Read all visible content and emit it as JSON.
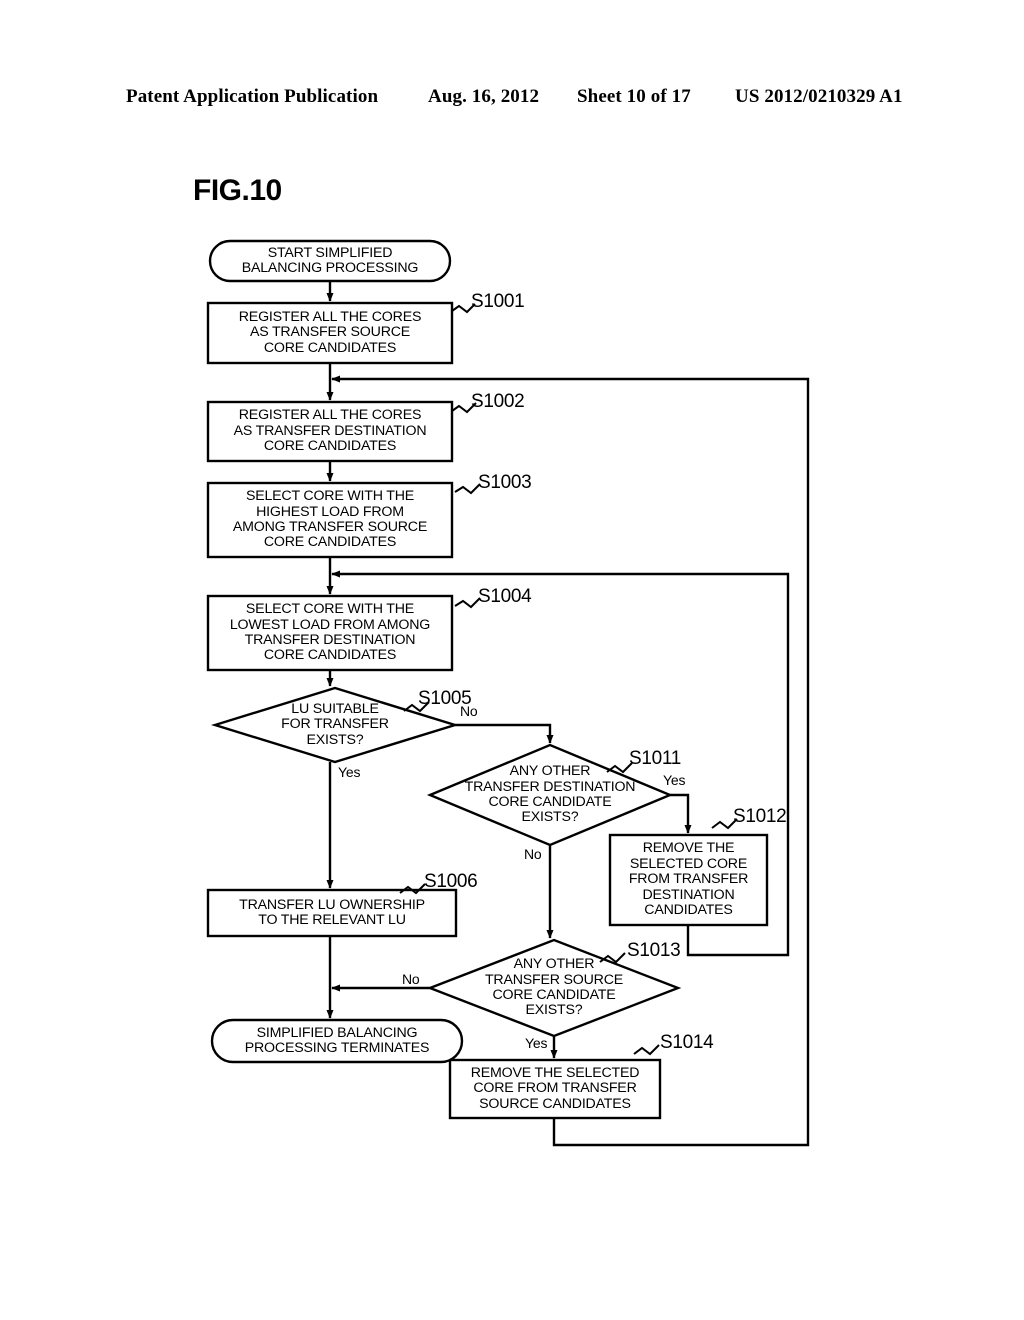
{
  "header": {
    "publication": "Patent Application Publication",
    "date": "Aug. 16, 2012",
    "sheet": "Sheet 10 of 17",
    "number": "US 2012/0210329 A1"
  },
  "figure": {
    "title": "FIG.10"
  },
  "chart_data": {
    "type": "diagram",
    "diagram_type": "flowchart",
    "title": "FIG.10",
    "nodes": [
      {
        "id": "start",
        "shape": "terminator",
        "step": "",
        "text": "START SIMPLIFIED\nBALANCING PROCESSING"
      },
      {
        "id": "s1001",
        "shape": "process",
        "step": "S1001",
        "text": "REGISTER ALL THE CORES\nAS TRANSFER SOURCE\nCORE CANDIDATES"
      },
      {
        "id": "s1002",
        "shape": "process",
        "step": "S1002",
        "text": "REGISTER ALL THE CORES\nAS TRANSFER DESTINATION\nCORE CANDIDATES"
      },
      {
        "id": "s1003",
        "shape": "process",
        "step": "S1003",
        "text": "SELECT CORE WITH THE\nHIGHEST LOAD FROM\nAMONG TRANSFER SOURCE\nCORE CANDIDATES"
      },
      {
        "id": "s1004",
        "shape": "process",
        "step": "S1004",
        "text": "SELECT CORE WITH THE\nLOWEST LOAD FROM AMONG\nTRANSFER DESTINATION\nCORE CANDIDATES"
      },
      {
        "id": "s1005",
        "shape": "decision",
        "step": "S1005",
        "text": "LU SUITABLE\nFOR TRANSFER\nEXISTS?"
      },
      {
        "id": "s1011",
        "shape": "decision",
        "step": "S1011",
        "text": "ANY OTHER\nTRANSFER DESTINATION\nCORE CANDIDATE\nEXISTS?"
      },
      {
        "id": "s1012",
        "shape": "process",
        "step": "S1012",
        "text": "REMOVE THE\nSELECTED CORE\nFROM TRANSFER\nDESTINATION\nCANDIDATES"
      },
      {
        "id": "s1006",
        "shape": "process",
        "step": "S1006",
        "text": "TRANSFER LU OWNERSHIP\nTO THE RELEVANT LU"
      },
      {
        "id": "s1013",
        "shape": "decision",
        "step": "S1013",
        "text": "ANY OTHER\nTRANSFER SOURCE\nCORE CANDIDATE\nEXISTS?"
      },
      {
        "id": "s1014",
        "shape": "process",
        "step": "S1014",
        "text": "REMOVE THE SELECTED\nCORE FROM TRANSFER\nSOURCE CANDIDATES"
      },
      {
        "id": "end",
        "shape": "terminator",
        "step": "",
        "text": "SIMPLIFIED BALANCING\nPROCESSING TERMINATES"
      }
    ],
    "edges": [
      {
        "from": "start",
        "to": "s1001",
        "label": ""
      },
      {
        "from": "s1001",
        "to": "s1002",
        "label": ""
      },
      {
        "from": "s1002",
        "to": "s1003",
        "label": ""
      },
      {
        "from": "s1003",
        "to": "s1004",
        "label": ""
      },
      {
        "from": "s1004",
        "to": "s1005",
        "label": ""
      },
      {
        "from": "s1005",
        "to": "s1006",
        "label": "Yes"
      },
      {
        "from": "s1005",
        "to": "s1011",
        "label": "No"
      },
      {
        "from": "s1011",
        "to": "s1012",
        "label": "Yes"
      },
      {
        "from": "s1011",
        "to": "s1013",
        "label": "No"
      },
      {
        "from": "s1012",
        "to": "s1004",
        "label": ""
      },
      {
        "from": "s1006",
        "to": "end",
        "label": ""
      },
      {
        "from": "s1013",
        "to": "end",
        "label": "No"
      },
      {
        "from": "s1013",
        "to": "s1014",
        "label": "Yes"
      },
      {
        "from": "s1014",
        "to": "s1002",
        "label": ""
      }
    ],
    "branch_labels": {
      "s1005_no": "No",
      "s1005_yes": "Yes",
      "s1011_yes": "Yes",
      "s1011_no": "No",
      "s1013_no": "No",
      "s1013_yes": "Yes"
    },
    "step_labels": [
      "S1001",
      "S1002",
      "S1003",
      "S1004",
      "S1005",
      "S1011",
      "S1012",
      "S1006",
      "S1013",
      "S1014"
    ],
    "colors": {
      "stroke": "#000000",
      "fill": "#ffffff",
      "background": "#ffffff"
    }
  }
}
